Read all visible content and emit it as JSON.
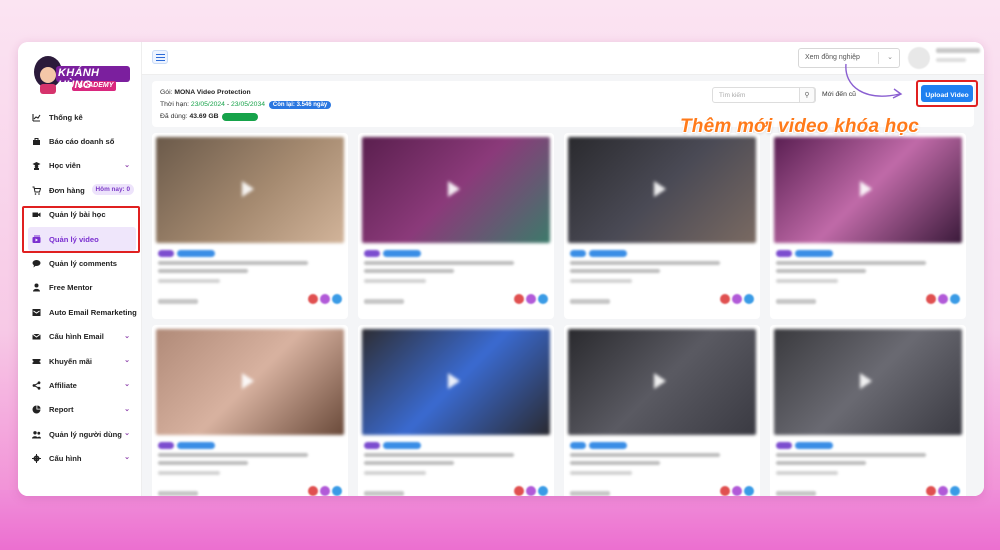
{
  "brand": {
    "logo_text": "KHÁNH HÙNG",
    "logo_sub": "ACADEMY"
  },
  "sidebar": {
    "items": [
      {
        "label": "Thống kê",
        "icon": "chart-line-icon",
        "chevron": false
      },
      {
        "label": "Báo cáo doanh số",
        "icon": "briefcase-icon",
        "chevron": false
      },
      {
        "label": "Học viên",
        "icon": "user-graduate-icon",
        "chevron": true
      },
      {
        "label": "Đơn hàng",
        "icon": "cart-icon",
        "chevron": false,
        "badge": "Hôm nay: 0"
      },
      {
        "label": "Quản lý bài học",
        "icon": "video-camera-icon",
        "chevron": false
      },
      {
        "label": "Quản lý video",
        "icon": "video-library-icon",
        "chevron": false,
        "active": true
      },
      {
        "label": "Quản lý comments",
        "icon": "comments-icon",
        "chevron": false
      },
      {
        "label": "Free Mentor",
        "icon": "person-icon",
        "chevron": false
      },
      {
        "label": "Auto Email Remarketing",
        "icon": "mail-box-icon",
        "chevron": false
      },
      {
        "label": "Cấu hình Email",
        "icon": "envelope-icon",
        "chevron": true
      },
      {
        "label": "Khuyến mãi",
        "icon": "ticket-icon",
        "chevron": true
      },
      {
        "label": "Affiliate",
        "icon": "share-icon",
        "chevron": true
      },
      {
        "label": "Report",
        "icon": "pie-chart-icon",
        "chevron": true
      },
      {
        "label": "Quản lý người dùng",
        "icon": "users-icon",
        "chevron": true
      },
      {
        "label": "Cấu hình",
        "icon": "gear-icon",
        "chevron": true
      }
    ]
  },
  "topbar": {
    "select_value": "Xem đồng nghiệp"
  },
  "info": {
    "package_label": "Gói:",
    "package_value": "MONA Video Protection",
    "term_label": "Thời hạn:",
    "term_start": "23/05/2024",
    "term_sep": " - ",
    "term_end": "23/05/2034",
    "remaining": "Còn lại: 3.546 ngày",
    "used_label": "Đã dùng:",
    "used_value": "43.69 GB",
    "unlimited": "Unlimited"
  },
  "toolbar": {
    "search_placeholder": "Tìm kiếm",
    "sort_label": "Mới đến cũ",
    "upload_label": "Upload Video"
  },
  "callout": "Thêm mới video khóa học",
  "colors": {
    "accent": "#1f80f0",
    "highlight": "#e02020",
    "callout": "#ff7a1a",
    "active_nav": "#7b2fd0"
  }
}
